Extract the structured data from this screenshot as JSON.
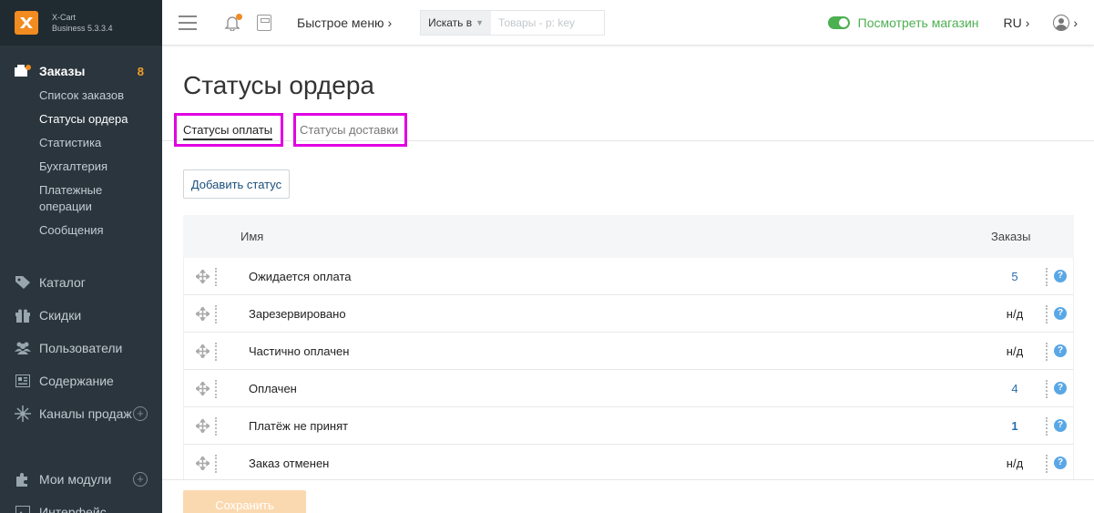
{
  "app": {
    "name": "X-Cart",
    "edition": "Business 5.3.3.4"
  },
  "sidebar": {
    "orders": {
      "label": "Заказы",
      "badge": "8",
      "items": [
        "Список заказов",
        "Статусы ордера",
        "Статистика",
        "Бухгалтерия",
        "Платежные операции",
        "Сообщения"
      ],
      "active_item": "Статусы ордера"
    },
    "nav": [
      {
        "label": "Каталог",
        "icon": "tag-icon"
      },
      {
        "label": "Скидки",
        "icon": "gift-icon"
      },
      {
        "label": "Пользователи",
        "icon": "users-icon"
      },
      {
        "label": "Содержание",
        "icon": "content-icon"
      },
      {
        "label": "Каналы продаж",
        "icon": "sales-channels-icon"
      },
      {
        "label": "Мои модули",
        "icon": "puzzle-icon"
      },
      {
        "label": "Интерфейс",
        "icon": "image-icon"
      }
    ]
  },
  "topbar": {
    "quick_menu": "Быстрое меню ›",
    "search_scope": "Искать в",
    "search_placeholder": "Товары - p: key",
    "view_store": "Посмотреть магазин",
    "language": "RU ›",
    "user_caret": "›"
  },
  "page": {
    "title": "Статусы ордера",
    "tabs": [
      {
        "label": "Статусы оплаты",
        "active": true
      },
      {
        "label": "Статусы доставки",
        "active": false
      }
    ],
    "add_button": "Добавить статус",
    "save_button": "Сохранить"
  },
  "table": {
    "columns": {
      "name": "Имя",
      "orders": "Заказы"
    },
    "rows": [
      {
        "name": "Ожидается оплата",
        "orders": "5"
      },
      {
        "name": "Зарезервировано",
        "orders": "н/д"
      },
      {
        "name": "Частично оплачен",
        "orders": "н/д"
      },
      {
        "name": "Оплачен",
        "orders": "4"
      },
      {
        "name": "Платёж не принят",
        "orders": "1"
      },
      {
        "name": "Заказ отменен",
        "orders": "н/д"
      }
    ]
  },
  "colors": {
    "sidebar_bg": "#2a353d",
    "accent_orange": "#f28b20",
    "link_blue": "#2a6db0",
    "store_green": "#4caf50",
    "tab_highlight": "#e100e1"
  }
}
